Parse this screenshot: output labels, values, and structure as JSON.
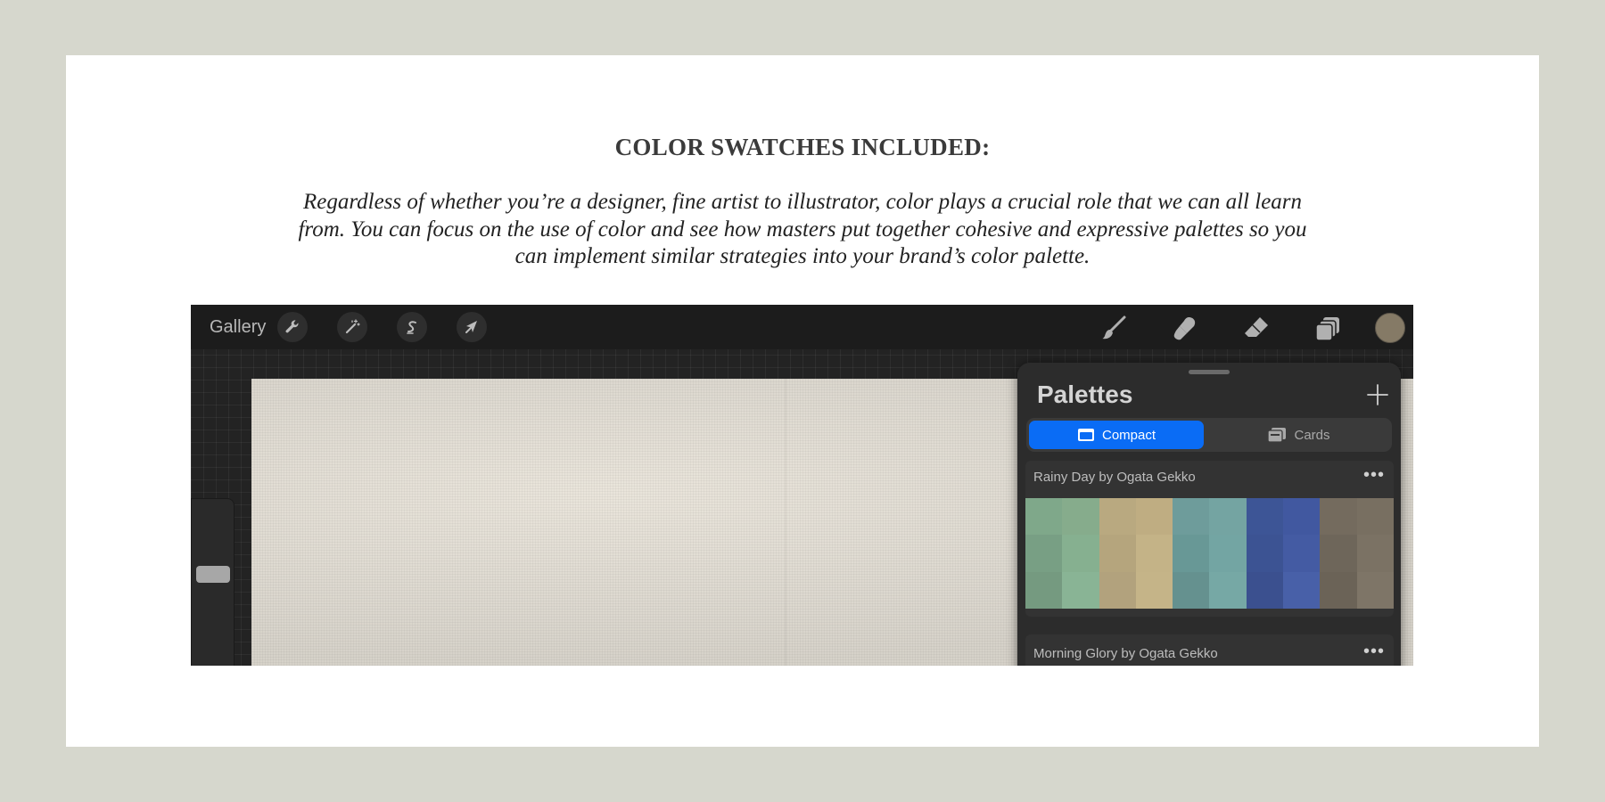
{
  "heading": "COLOR SWATCHES INCLUDED:",
  "description": "Regardless of whether you’re a designer, fine artist to illustrator, color plays a crucial role that we can all learn from. You can focus on the use of color and see how masters put together cohesive and expressive palettes so you can implement similar strategies into your brand’s color palette.",
  "app": {
    "gallery_label": "Gallery",
    "left_tools": [
      "wrench-icon",
      "magic-wand-icon",
      "selection-icon",
      "move-arrow-icon"
    ],
    "right_tools": [
      "brush-icon",
      "smudge-icon",
      "eraser-icon",
      "layers-icon"
    ],
    "current_color": "#857a66",
    "palettes_panel": {
      "title": "Palettes",
      "tabs": [
        {
          "label": "Compact",
          "active": true
        },
        {
          "label": "Cards",
          "active": false
        }
      ],
      "palettes": [
        {
          "name": "Rainy Day by Ogata Gekko",
          "swatches": [
            [
              "#7fa88a",
              "#86ac8c",
              "#b9a980",
              "#bfad82",
              "#6e9c9b",
              "#74a4a2",
              "#3d5596",
              "#4158a0",
              "#746b5e",
              "#786f61"
            ],
            [
              "#789f84",
              "#86b090",
              "#b5a57d",
              "#c4b387",
              "#689896",
              "#73a5a3",
              "#3c5393",
              "#445ba3",
              "#6e665a",
              "#7b7264"
            ],
            [
              "#759a80",
              "#89b495",
              "#b2a27d",
              "#c5b488",
              "#65918f",
              "#76a8a5",
              "#3b508f",
              "#4860a8",
              "#6b6357",
              "#7e7567"
            ]
          ]
        },
        {
          "name": "Morning Glory by Ogata Gekko",
          "swatches": []
        }
      ]
    }
  }
}
